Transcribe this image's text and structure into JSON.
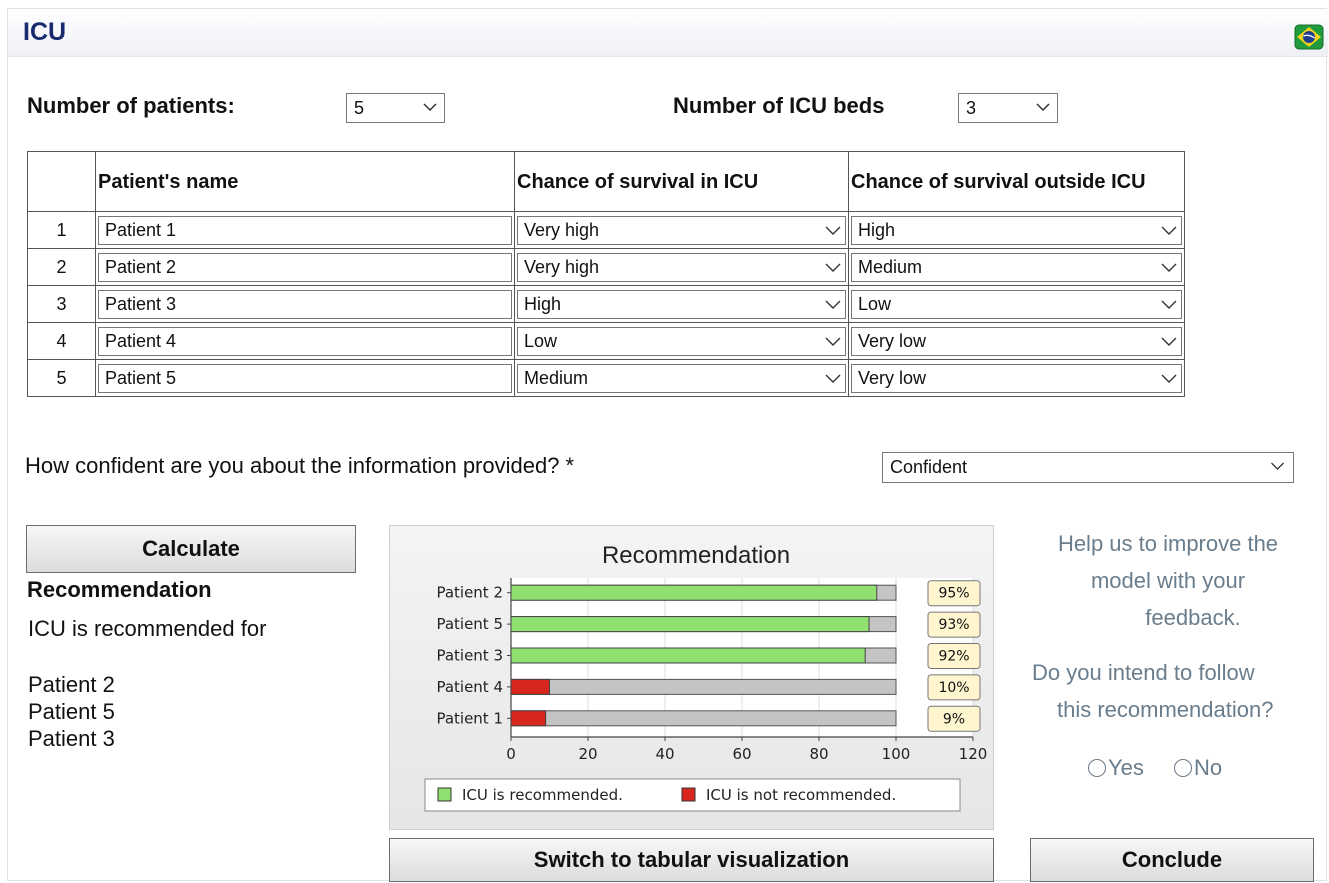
{
  "window": {
    "title": "ICU",
    "flag_icon": "brazil-flag-icon"
  },
  "controls": {
    "patients_label": "Number of patients:",
    "patients_value": "5",
    "beds_label": "Number of ICU beds",
    "beds_value": "3"
  },
  "table": {
    "headers": [
      "",
      "Patient's name",
      "Chance of survival in ICU",
      "Chance of survival outside ICU"
    ],
    "rows": [
      {
        "num": "1",
        "name": "Patient 1",
        "in_icu": "Very high",
        "outside": "High"
      },
      {
        "num": "2",
        "name": "Patient 2",
        "in_icu": "Very high",
        "outside": "Medium"
      },
      {
        "num": "3",
        "name": "Patient 3",
        "in_icu": "High",
        "outside": "Low"
      },
      {
        "num": "4",
        "name": "Patient 4",
        "in_icu": "Low",
        "outside": "Very low"
      },
      {
        "num": "5",
        "name": "Patient 5",
        "in_icu": "Medium",
        "outside": "Very low"
      }
    ]
  },
  "confidence": {
    "question": "How confident are you about the information provided? *",
    "value": "Confident"
  },
  "calculate_label": "Calculate",
  "recommendation": {
    "heading": "Recommendation",
    "text": "ICU is recommended for",
    "patients": [
      "Patient 2",
      "Patient 5",
      "Patient 3"
    ]
  },
  "chart_data": {
    "type": "bar",
    "orientation": "horizontal",
    "stacked": true,
    "title": "Recommendation",
    "categories": [
      "Patient 2",
      "Patient 5",
      "Patient 3",
      "Patient 4",
      "Patient 1"
    ],
    "values": [
      95,
      93,
      92,
      10,
      9
    ],
    "data_labels": [
      "95%",
      "93%",
      "92%",
      "10%",
      "9%"
    ],
    "recommended": [
      true,
      true,
      true,
      false,
      false
    ],
    "remainder_max": 100,
    "xlim": [
      0,
      120
    ],
    "xticks": [
      "0",
      "20",
      "40",
      "60",
      "80",
      "100",
      "120"
    ],
    "legend": [
      "ICU is recommended.",
      "ICU is not recommended."
    ],
    "legend_position": "bottom",
    "colors": {
      "recommended": "#8fe06e",
      "not_recommended": "#d7261e",
      "remainder": "#c4c4c4",
      "label_bg": "#fff6d0"
    },
    "grid": true
  },
  "feedback": {
    "line1": "Help us to improve the",
    "line2": "model with your",
    "line3": "feedback.",
    "q1": "Do you intend to follow",
    "q2": "this recommendation?",
    "yes": "Yes",
    "no": "No"
  },
  "switch_label": "Switch to tabular visualization",
  "conclude_label": "Conclude"
}
